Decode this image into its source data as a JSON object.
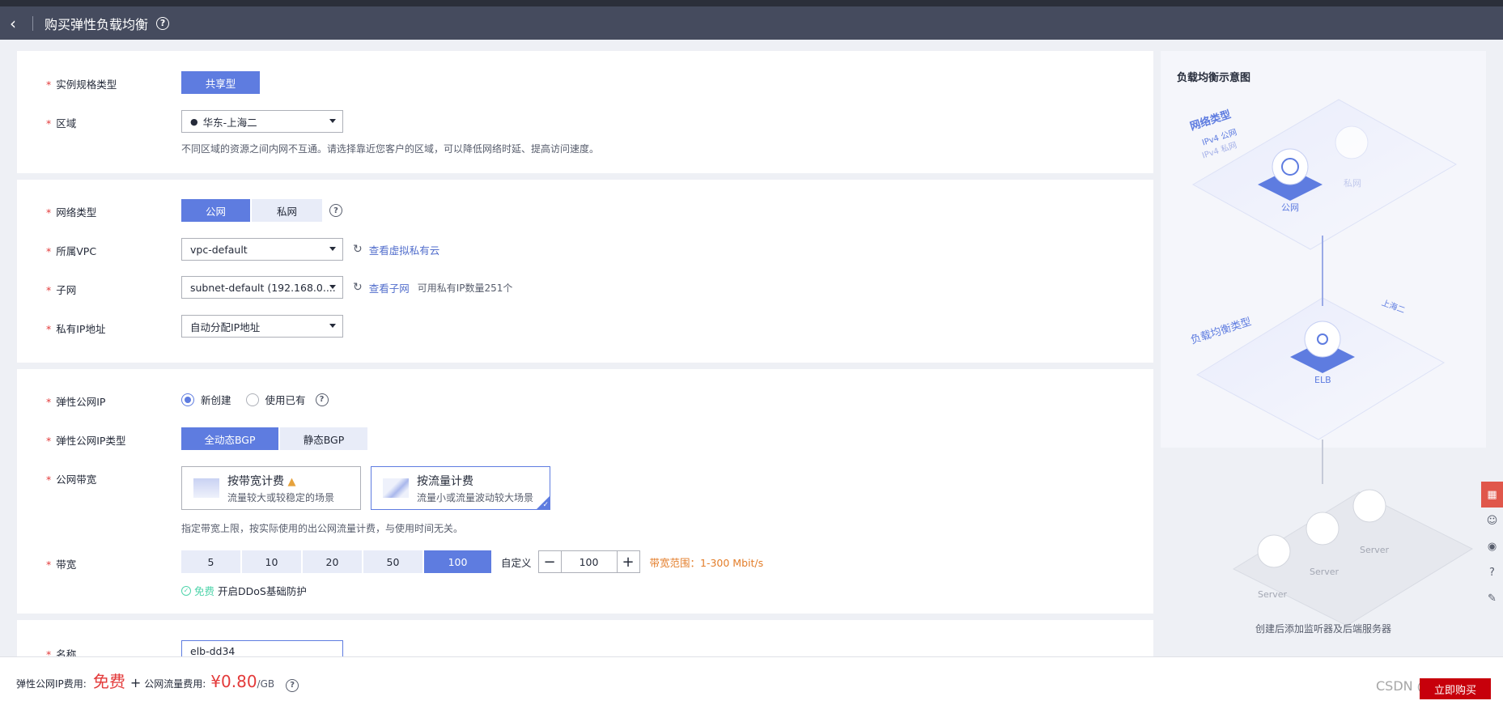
{
  "header": {
    "back_icon": "chevron-left-icon",
    "title": "购买弹性负载均衡",
    "help_icon": "question-circle-icon"
  },
  "spec": {
    "instance_type_label": "实例规格类型",
    "instance_type_value": "共享型",
    "region_label": "区域",
    "region_value": "华东-上海二",
    "region_hint": "不同区域的资源之间内网不互通。请选择靠近您客户的区域，可以降低网络时延、提高访问速度。"
  },
  "network": {
    "network_type_label": "网络类型",
    "network_type_options": [
      "公网",
      "私网"
    ],
    "vpc_label": "所属VPC",
    "vpc_value": "vpc-default",
    "vpc_link": "查看虚拟私有云",
    "subnet_label": "子网",
    "subnet_value": "subnet-default (192.168.0....",
    "subnet_link": "查看子网",
    "subnet_available": "可用私有IP数量251个",
    "private_ip_label": "私有IP地址",
    "private_ip_value": "自动分配IP地址"
  },
  "eip": {
    "eip_label": "弹性公网IP",
    "eip_new": "新创建",
    "eip_existing": "使用已有",
    "eip_type_label": "弹性公网IP类型",
    "eip_type_options": [
      "全动态BGP",
      "静态BGP"
    ],
    "bandwidth_billing_label": "公网带宽",
    "billing_bandwidth_title": "按带宽计费",
    "billing_bandwidth_desc": "流量较大或较稳定的场景",
    "billing_traffic_title": "按流量计费",
    "billing_traffic_desc": "流量小或流量波动较大场景",
    "billing_hint": "指定带宽上限，按实际使用的出公网流量计费，与使用时间无关。",
    "bandwidth_label": "带宽",
    "bandwidth_options": [
      "5",
      "10",
      "20",
      "50",
      "100"
    ],
    "custom_label": "自定义",
    "bandwidth_value": "100",
    "bandwidth_range": "带宽范围：1-300 Mbit/s",
    "ddos_free": "免费",
    "ddos_text": "开启DDoS基础防护"
  },
  "name": {
    "label": "名称",
    "value": "elb-dd34"
  },
  "footer": {
    "eip_fee_label": "弹性公网IP费用:",
    "eip_fee_value": "免费",
    "plus": "+",
    "traffic_fee_label": "公网流量费用:",
    "traffic_fee_value": "¥0.80",
    "traffic_fee_unit": "/GB",
    "submit_button": "立即购买",
    "watermark": "CSDN @tdmjun"
  },
  "diagram": {
    "title": "负载均衡示意图",
    "network_type_label": "网络类型",
    "ipv4_public": "IPv4 公网",
    "ipv4_private": "IPv4 私网",
    "public_label": "公网",
    "private_label": "私网",
    "lb_type_label": "负载均衡类型",
    "region_tag": "上海二",
    "elb_label": "ELB",
    "server_label": "Server",
    "caption": "创建后添加监听器及后端服务器"
  },
  "colors": {
    "primary": "#5e7ce0",
    "header_bg": "#454b5e",
    "price": "#e33a3a",
    "warning_text": "#e37d29",
    "success": "#50d4ab"
  }
}
